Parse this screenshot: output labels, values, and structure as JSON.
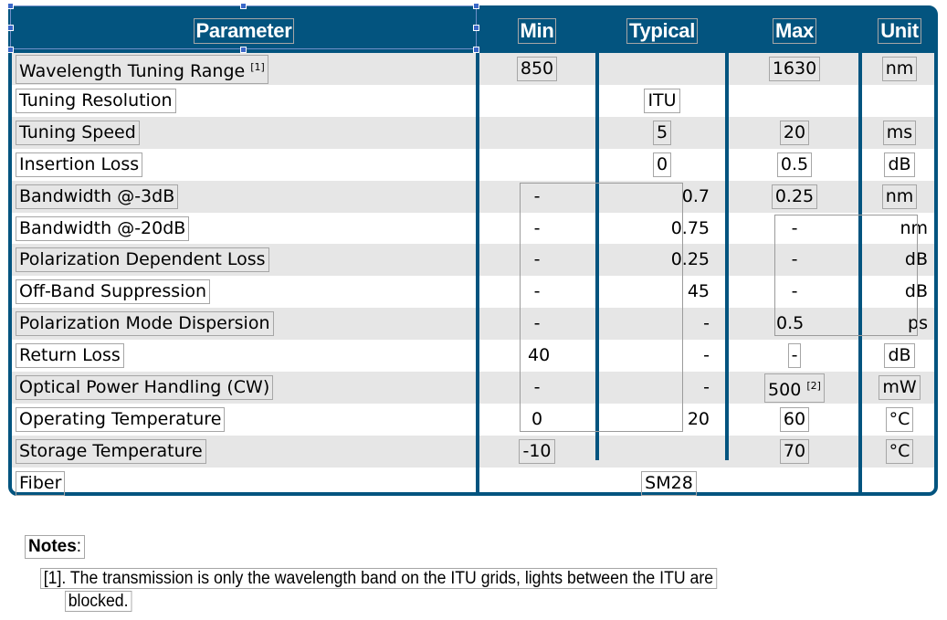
{
  "table": {
    "headers": [
      "Parameter",
      "Min",
      "Typical",
      "Max",
      "Unit"
    ],
    "rows": [
      {
        "parameter": "Wavelength Tuning Range",
        "parameter_note": "[1]",
        "min": "850",
        "typical": "",
        "max": "1630",
        "max_note": "",
        "unit": "nm"
      },
      {
        "parameter": "Tuning Resolution",
        "parameter_note": "",
        "min": "",
        "typical": "ITU",
        "max": "",
        "max_note": "",
        "unit": ""
      },
      {
        "parameter": "Tuning Speed",
        "parameter_note": "",
        "min": "",
        "typical": "5",
        "max": "20",
        "max_note": "",
        "unit": "ms"
      },
      {
        "parameter": "Insertion Loss",
        "parameter_note": "",
        "min": "",
        "typical": "0",
        "max": "0.5",
        "max_note": "",
        "unit": "dB"
      },
      {
        "parameter": "Bandwidth @-3dB",
        "parameter_note": "",
        "min": "-",
        "typical": "0.7",
        "max": "0.25",
        "max_note": "",
        "unit": "nm"
      },
      {
        "parameter": "Bandwidth @-20dB",
        "parameter_note": "",
        "min": "-",
        "typical": "0.75",
        "max": "-",
        "max_note": "",
        "unit": "nm"
      },
      {
        "parameter": "Polarization Dependent Loss",
        "parameter_note": "",
        "min": "-",
        "typical": "0.25",
        "max": "-",
        "max_note": "",
        "unit": "dB"
      },
      {
        "parameter": "Off-Band Suppression",
        "parameter_note": "",
        "min": "-",
        "typical": "45",
        "max": "-",
        "max_note": "",
        "unit": "dB"
      },
      {
        "parameter": "Polarization Mode Dispersion",
        "parameter_note": "",
        "min": "-",
        "typical": "-",
        "max": "0.5",
        "max_note": "",
        "unit": "ps"
      },
      {
        "parameter": "Return Loss",
        "parameter_note": "",
        "min": "40",
        "typical": "-",
        "max": "-",
        "max_note": "",
        "unit": "dB"
      },
      {
        "parameter": "Optical Power Handling (CW)",
        "parameter_note": "",
        "min": "-",
        "typical": "-",
        "max": "500",
        "max_note": "[2]",
        "unit": "mW"
      },
      {
        "parameter": "Operating Temperature",
        "parameter_note": "",
        "min": "0",
        "typical": "20",
        "max": "60",
        "max_note": "",
        "unit": "°C"
      },
      {
        "parameter": "Storage Temperature",
        "parameter_note": "",
        "min": "-10",
        "typical": "",
        "max": "70",
        "max_note": "",
        "unit": "°C"
      },
      {
        "parameter": "Fiber",
        "parameter_note": "",
        "min": "",
        "typical": "SM28",
        "max": "",
        "max_note": "",
        "unit": ""
      }
    ]
  },
  "notes": {
    "title": "Notes",
    "colon": ":",
    "items": [
      {
        "line1": "[1]. The transmission is only the wavelength band on the ITU grids, lights between the ITU are",
        "line2": "blocked."
      }
    ]
  },
  "colors": {
    "header_bg": "#03547F",
    "shade_row": "#e6e6e6",
    "selection": "#3a67c8"
  }
}
